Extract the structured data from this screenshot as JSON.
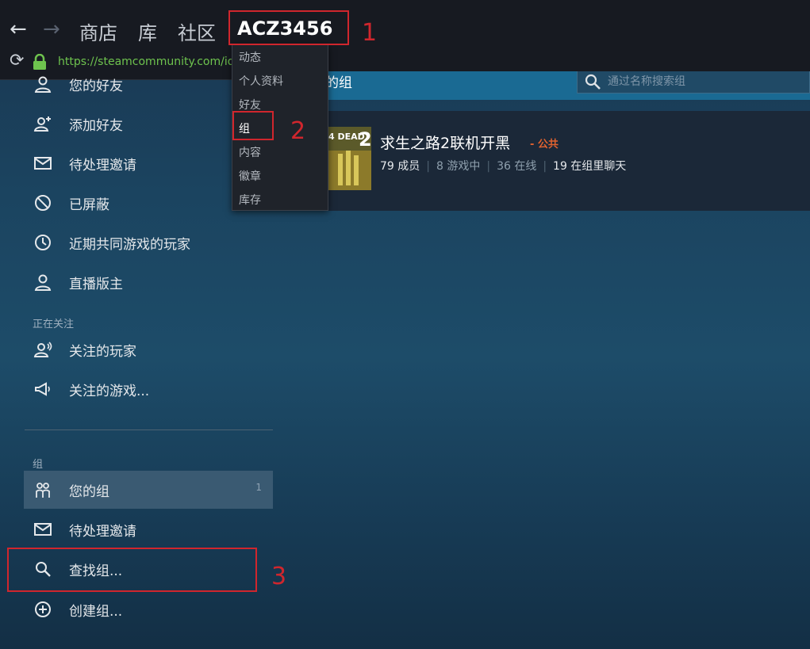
{
  "topbar": {
    "back_icon": "arrow-left-icon",
    "forward_icon": "arrow-right-icon",
    "nav": {
      "store": "商店",
      "library": "库",
      "community": "社区",
      "username": "ACZ3456"
    },
    "url": "https://steamcommunity.com/id/A",
    "url_color": "#6ec34e"
  },
  "dropdown": {
    "items": [
      "动态",
      "个人资料",
      "好友",
      "组",
      "内容",
      "徽章",
      "库存"
    ]
  },
  "annotations": {
    "n1": "1",
    "n2": "2",
    "n3": "3",
    "color": "#d0262d"
  },
  "sidebar": {
    "friends_items": [
      {
        "label": "您的好友",
        "icon": "person-icon"
      },
      {
        "label": "添加好友",
        "icon": "add-person-icon"
      },
      {
        "label": "待处理邀请",
        "icon": "envelope-icon"
      },
      {
        "label": "已屏蔽",
        "icon": "blocked-icon"
      },
      {
        "label": "近期共同游戏的玩家",
        "icon": "clock-icon"
      },
      {
        "label": "直播版主",
        "icon": "person-icon"
      }
    ],
    "following_label": "正在关注",
    "following_items": [
      {
        "label": "关注的玩家",
        "icon": "person-follow-icon"
      },
      {
        "label": "关注的游戏...",
        "icon": "megaphone-icon"
      }
    ],
    "groups_label": "组",
    "group_items": [
      {
        "label": "您的组",
        "icon": "group-icon",
        "count": "1"
      },
      {
        "label": "待处理邀请",
        "icon": "envelope-icon"
      },
      {
        "label": "查找组...",
        "icon": "search-icon"
      },
      {
        "label": "创建组...",
        "icon": "plus-circle-icon"
      }
    ]
  },
  "main": {
    "header_title": "的组",
    "search_placeholder": "通过名称搜索组",
    "group": {
      "name": "求生之路2联机开黑",
      "visibility": "- 公共",
      "members": "79 成员",
      "in_game": "8 游戏中",
      "online": "36 在线",
      "in_chat": "19 在组里聊天"
    }
  }
}
